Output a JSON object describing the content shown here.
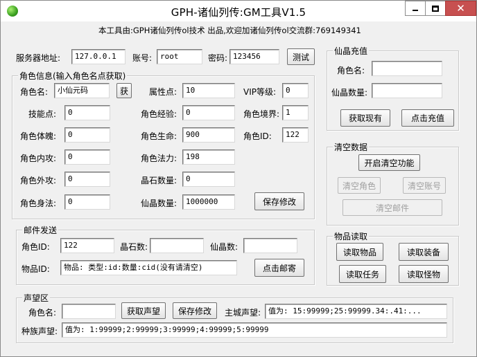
{
  "window": {
    "title": "GPH-诸仙列传:GM工具V1.5"
  },
  "banner": "本工具由:GPH诸仙列传ol技术 出品,欢迎加诸仙列传ol交流群:769149341",
  "server": {
    "address_label": "服务器地址:",
    "address": "127.0.0.1",
    "account_label": "账号:",
    "account": "root",
    "password_label": "密码:",
    "password": "123456",
    "test_button": "测试"
  },
  "role_info": {
    "title": "角色信息(输入角色名点获取)",
    "name_label": "角色名:",
    "name": "小仙元码",
    "fetch_button": "获",
    "attr_points_label": "属性点:",
    "attr_points": "10",
    "vip_label": "VIP等级:",
    "vip": "0",
    "skill_points_label": "技能点:",
    "skill_points": "0",
    "exp_label": "角色经验:",
    "exp": "0",
    "realm_label": "角色境界:",
    "realm": "1",
    "physique_label": "角色体魄:",
    "physique": "0",
    "hp_label": "角色生命:",
    "hp": "900",
    "role_id_label": "角色ID:",
    "role_id": "122",
    "inner_attack_label": "角色内攻:",
    "inner_attack": "0",
    "mana_label": "角色法力:",
    "mana": "198",
    "outer_attack_label": "角色外攻:",
    "outer_attack": "0",
    "crystal_label": "晶石数量:",
    "crystal": "0",
    "agility_label": "角色身法:",
    "agility": "0",
    "xianjing_label": "仙晶数量:",
    "xianjing": "1000000",
    "save_button": "保存修改"
  },
  "mail": {
    "title": "邮件发送",
    "role_id_label": "角色ID:",
    "role_id": "122",
    "crystal_label": "晶石数:",
    "crystal": "",
    "xianjing_label": "仙晶数:",
    "xianjing": "",
    "item_id_label": "物品ID:",
    "item_id": "物品: 类型:id:数量:cid(没有请清空)",
    "send_button": "点击邮寄"
  },
  "reputation": {
    "title": "声望区",
    "name_label": "角色名:",
    "name": "",
    "fetch_button": "获取声望",
    "save_button": "保存修改",
    "city_label": "主城声望:",
    "city_value": "值为: 15:99999;25:99999.34:.41:...",
    "race_label": "种族声望:",
    "race_value": "值为: 1:99999;2:99999;3:99999;4:99999;5:99999"
  },
  "recharge": {
    "title": "仙晶充值",
    "name_label": "角色名:",
    "name": "",
    "amount_label": "仙晶数量:",
    "amount": "",
    "get_button": "获取现有",
    "recharge_button": "点击充值"
  },
  "clear": {
    "title": "清空数据",
    "enable_button": "开启清空功能",
    "clear_role_button": "清空角色",
    "clear_account_button": "清空账号",
    "clear_mail_button": "清空邮件"
  },
  "item_read": {
    "title": "物品读取",
    "read_items": "读取物品",
    "read_equipment": "读取装备",
    "read_tasks": "读取任务",
    "read_monsters": "读取怪物"
  }
}
